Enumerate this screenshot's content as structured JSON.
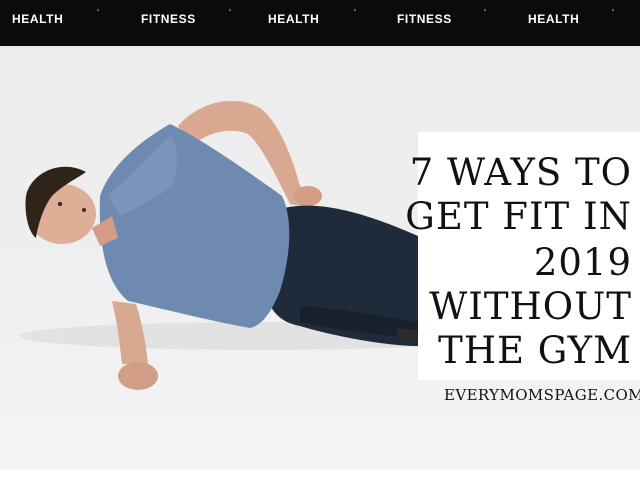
{
  "nav": {
    "tags": [
      "HEALTH",
      "FITNESS",
      "HEALTH",
      "FITNESS",
      "HEALTH"
    ],
    "separator": "'"
  },
  "hero": {
    "title_lines": [
      "7 WAYS TO",
      "GET FIT IN",
      "2019",
      "WITHOUT",
      "THE GYM"
    ],
    "site": "EVERYMOMSPAGE.COM"
  },
  "colors": {
    "bar": "#0b0b0b",
    "shirt": "#6f8ab0",
    "pants": "#1f2a3a"
  }
}
